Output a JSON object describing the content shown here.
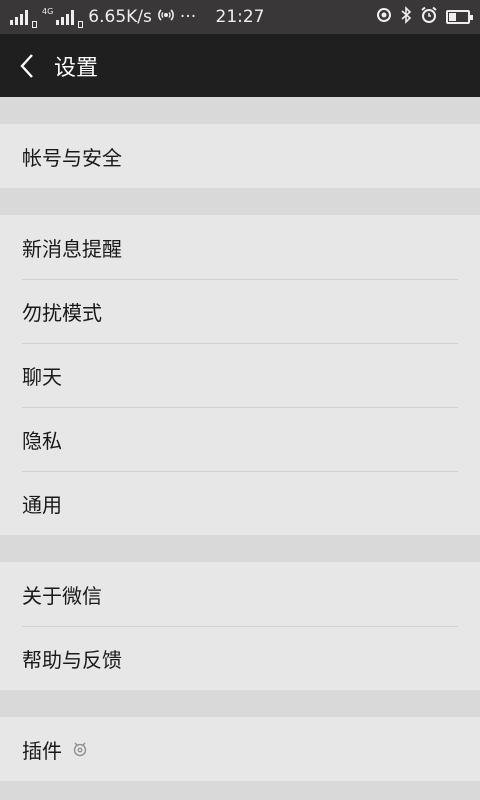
{
  "status_bar": {
    "speed": "6.65K/s",
    "network_type": "4G",
    "more": "···",
    "time": "21:27",
    "battery_level": 0.3
  },
  "header": {
    "title": "设置",
    "back_icon": "back-chevron-icon"
  },
  "groups": [
    {
      "items": [
        {
          "label": "帐号与安全"
        }
      ]
    },
    {
      "items": [
        {
          "label": "新消息提醒"
        },
        {
          "label": "勿扰模式"
        },
        {
          "label": "聊天"
        },
        {
          "label": "隐私"
        },
        {
          "label": "通用"
        }
      ]
    },
    {
      "items": [
        {
          "label": "关于微信"
        },
        {
          "label": "帮助与反馈"
        }
      ]
    },
    {
      "items": [
        {
          "label": "插件",
          "icon": "plugin-icon"
        }
      ]
    }
  ]
}
